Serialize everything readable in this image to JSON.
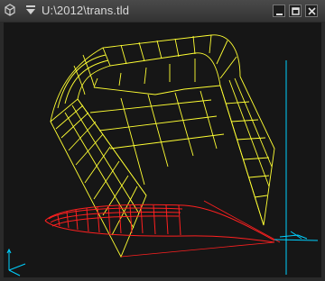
{
  "window": {
    "title": "U:\\2012\\trans.tld",
    "buttons": [
      "minimize",
      "maximize",
      "close"
    ]
  },
  "viewport": {
    "background": "#161616",
    "colors": {
      "surface": "#ffff33",
      "curve": "#ff2020",
      "axis": "#00d0ff"
    },
    "icons": [
      "triad-icon",
      "origin-axis-icon"
    ]
  }
}
